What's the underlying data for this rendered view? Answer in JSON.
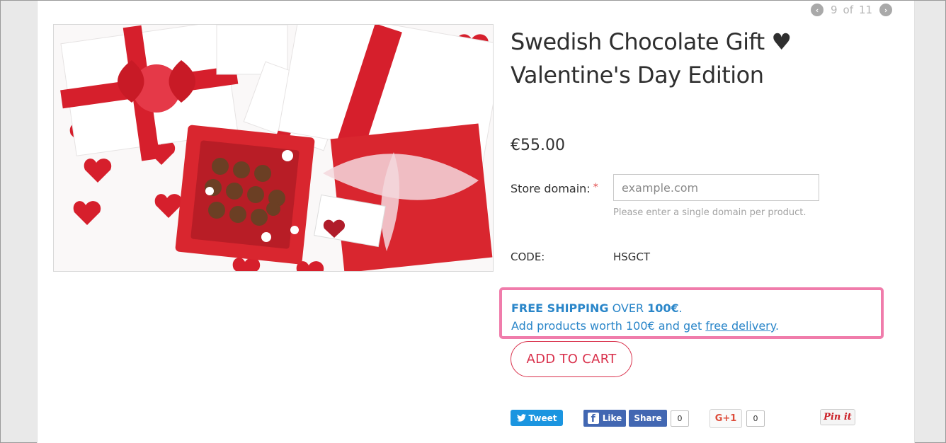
{
  "pager": {
    "prev_icon": "chevron-left-icon",
    "current": "9",
    "of": "of",
    "total": "11",
    "next_icon": "chevron-right-icon"
  },
  "product": {
    "title_line1": "Swedish Chocolate Gift ♥",
    "title_line2": "Valentine's Day Edition",
    "price": "€55.00",
    "image_alt": "Valentine gift boxes with chocolates"
  },
  "form": {
    "domain_label": "Store domain:",
    "required_mark": "*",
    "domain_placeholder": "example.com",
    "domain_value": "",
    "domain_help": "Please enter a single domain per product."
  },
  "code": {
    "label": "CODE:",
    "value": "HSGCT"
  },
  "shipping": {
    "strong1": "FREE SHIPPING",
    "middle": " OVER ",
    "strong2": "100€",
    "end": ".",
    "line2_prefix": "Add products worth 100€ and get ",
    "line2_link": "free delivery",
    "line2_suffix": ".",
    "border_color": "#f07cab",
    "text_color": "#2a86c9"
  },
  "cart": {
    "label": "ADD TO CART",
    "color": "#d9304b"
  },
  "social": {
    "tweet_label": "Tweet",
    "like_label": "Like",
    "share_label": "Share",
    "fb_count": "0",
    "gplus_label": "G+1",
    "gplus_count": "0",
    "pin_label": "Pin it"
  }
}
